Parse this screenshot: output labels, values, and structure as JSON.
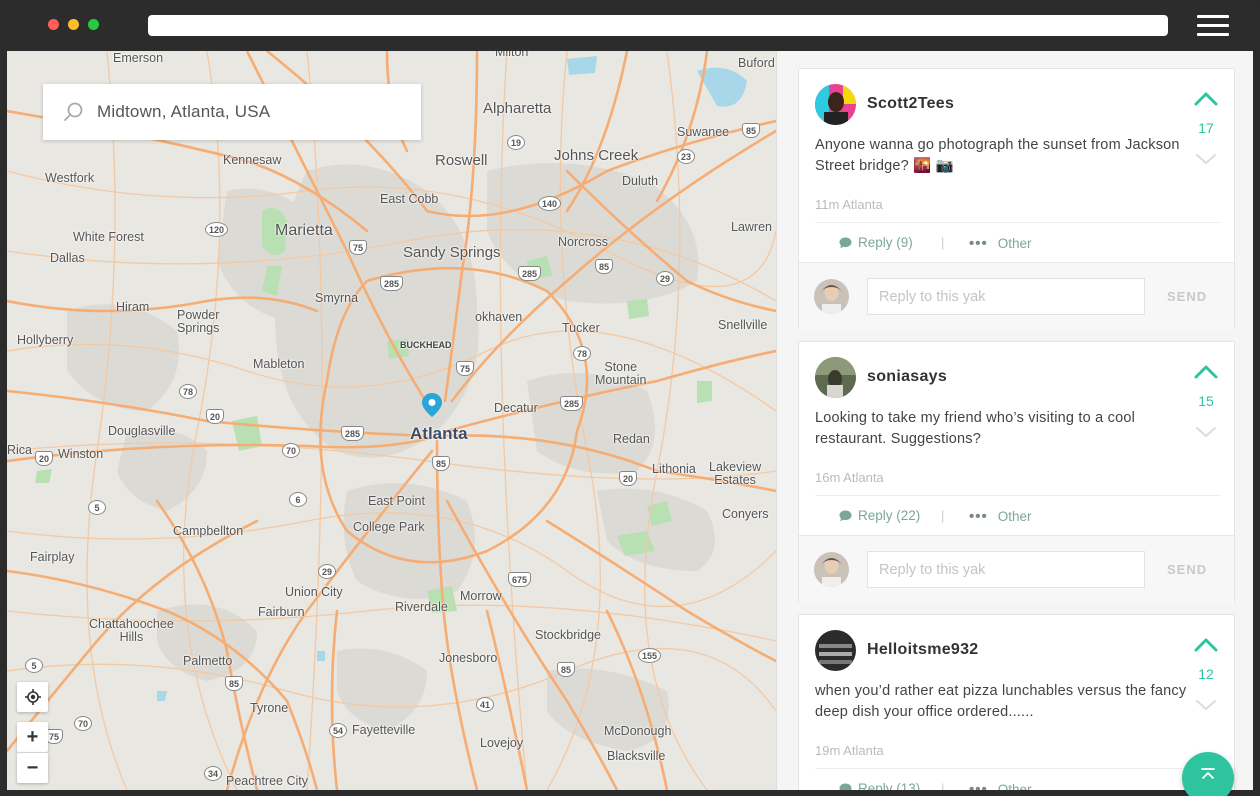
{
  "window": {
    "url": ""
  },
  "map": {
    "search_value": "Midtown, Atlanta, USA",
    "labels": {
      "emerson": "Emerson",
      "milton": "Milton",
      "buford": "Buford",
      "alpharetta": "Alpharetta",
      "suwanee": "Suwanee",
      "kennesaw": "Kennesaw",
      "roswell": "Roswell",
      "johns_creek": "Johns Creek",
      "duluth": "Duluth",
      "westfork": "Westfork",
      "east_cobb": "East Cobb",
      "lawrenceville": "Lawren",
      "white_forest": "White Forest",
      "marietta": "Marietta",
      "sandy_springs": "Sandy Springs",
      "norcross": "Norcross",
      "dallas": "Dallas",
      "smyrna": "Smyrna",
      "hiram": "Hiram",
      "powder_springs": "Powder\nSprings",
      "brookhaven": "okhaven",
      "tucker": "Tucker",
      "snellville": "Snellville",
      "hollyberry": "Hollyberry",
      "buckhead": "BUCKHEAD",
      "mableton": "Mableton",
      "stone_mountain": "Stone\nMountain",
      "decatur": "Decatur",
      "douglasville": "Douglasville",
      "atlanta": "Atlanta",
      "redan": "Redan",
      "rica": "Rica",
      "winston": "Winston",
      "lithonia": "Lithonia",
      "lakeview_estates": "Lakeview\nEstates",
      "east_point": "East Point",
      "campbellton": "Campbellton",
      "college_park": "College Park",
      "conyers": "Conyers",
      "fairplay": "Fairplay",
      "union_city": "Union City",
      "morrow": "Morrow",
      "riverdale": "Riverdale",
      "fairburn": "Fairburn",
      "chattahoochee_hills": "Chattahoochee\nHills",
      "stockbridge": "Stockbridge",
      "palmetto": "Palmetto",
      "jonesboro": "Jonesboro",
      "tyrone": "Tyrone",
      "fayetteville": "Fayetteville",
      "lovejoy": "Lovejoy",
      "mcdonough": "McDonough",
      "blacksville": "Blacksville",
      "peachtree_city": "Peachtree City"
    },
    "shields": [
      "19",
      "85",
      "23",
      "140",
      "120",
      "75",
      "285",
      "85",
      "29",
      "285",
      "78",
      "20",
      "285",
      "75",
      "85",
      "285",
      "20",
      "70",
      "6",
      "5",
      "29",
      "675",
      "85",
      "155",
      "41",
      "85",
      "75",
      "54",
      "34",
      "70",
      "5",
      "78",
      "20"
    ],
    "zoom_in": "+",
    "zoom_out": "−"
  },
  "feed": {
    "posts": [
      {
        "username": "Scott2Tees",
        "body": "Anyone wanna go photograph the sunset from Jackson Street bridge? 🌇 📷",
        "votes": "17",
        "meta": "11m Atlanta",
        "reply_label": "Reply (9)",
        "other_label": "Other",
        "reply_placeholder": "Reply to this yak",
        "send_label": "SEND"
      },
      {
        "username": "soniasays",
        "body": "Looking to take my friend who’s visiting to a cool restaurant. Suggestions?",
        "votes": "15",
        "meta": "16m Atlanta",
        "reply_label": "Reply (22)",
        "other_label": "Other",
        "reply_placeholder": "Reply to this yak",
        "send_label": "SEND"
      },
      {
        "username": "Helloitsme932",
        "body": "when you’d rather eat pizza lunchables versus the fancy deep dish your office ordered......",
        "votes": "12",
        "meta": "19m Atlanta",
        "reply_label": "Reply (13)",
        "other_label": "Other"
      }
    ]
  },
  "colors": {
    "accent": "#2ec4a0",
    "road": "#f5b07a",
    "park": "#a8dba8",
    "water": "#a3d4e8"
  }
}
